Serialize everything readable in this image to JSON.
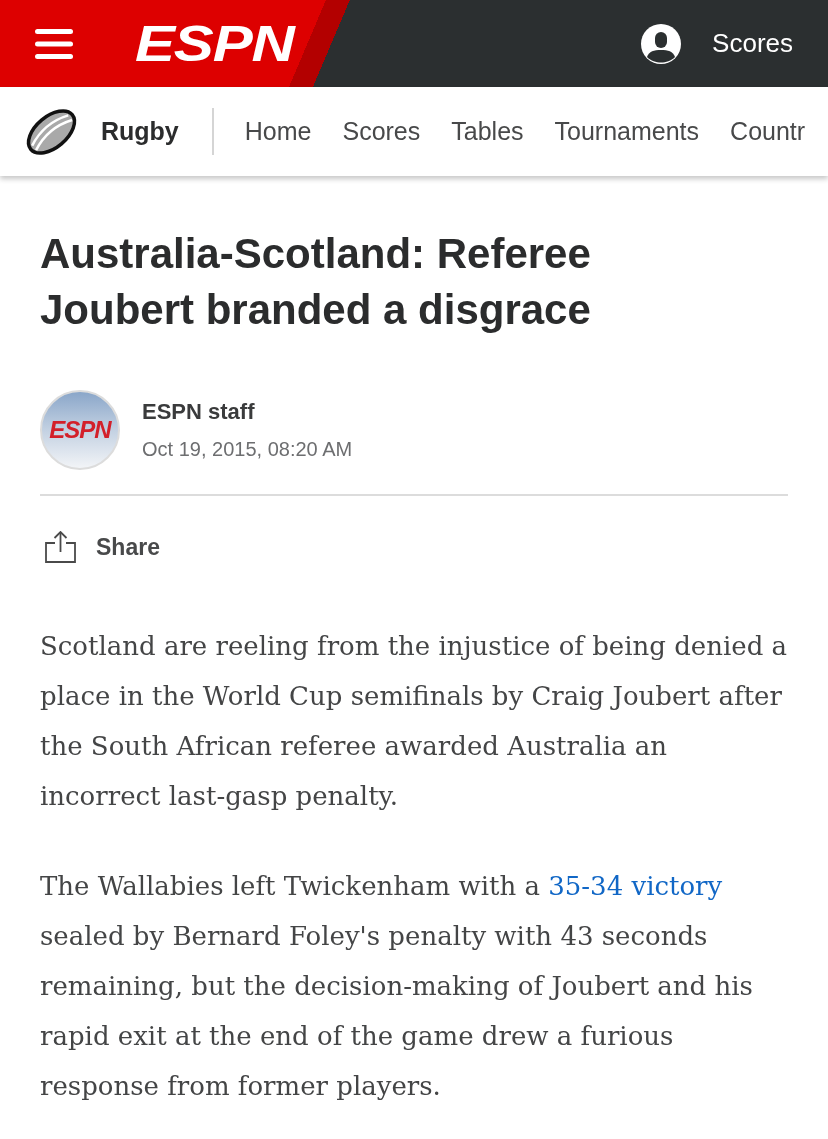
{
  "top_bar": {
    "logo": "ESPN",
    "scores_link": "Scores"
  },
  "sport_nav": {
    "sport": "Rugby",
    "items": [
      {
        "label": "Home"
      },
      {
        "label": "Scores"
      },
      {
        "label": "Tables"
      },
      {
        "label": "Tournaments"
      },
      {
        "label": "Countr"
      }
    ]
  },
  "article": {
    "headline": "Australia-Scotland: Referee Joubert branded a disgrace",
    "byline": {
      "avatar_logo": "ESPN",
      "author": "ESPN staff",
      "date": "Oct 19, 2015, 08:20 AM"
    },
    "share": "Share",
    "paragraphs": [
      [
        {
          "kind": "text",
          "text": "Scotland are reeling from the injustice of being denied a place in the World Cup semifinals by Craig Joubert after the South African referee awarded Australia an incorrect last-gasp penalty."
        }
      ],
      [
        {
          "kind": "text",
          "text": "The Wallabies left Twickenham with a "
        },
        {
          "kind": "link",
          "text": "35-34 victory"
        },
        {
          "kind": "text",
          "text": " sealed by Bernard Foley's penalty with 43 seconds remaining, but the decision-making of Joubert and his rapid exit at the end of the game drew a furious response from former players."
        }
      ]
    ]
  }
}
